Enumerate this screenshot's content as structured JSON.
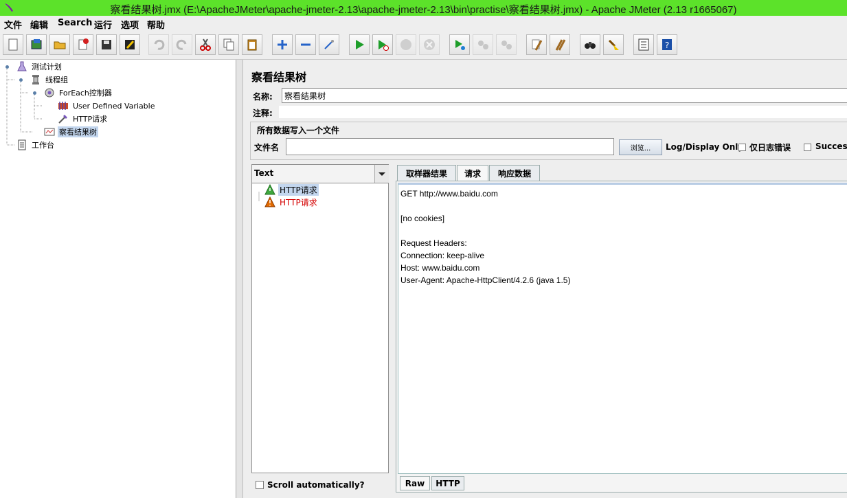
{
  "window": {
    "title": "察看结果树.jmx (E:\\ApacheJMeter\\apache-jmeter-2.13\\apache-jmeter-2.13\\bin\\practise\\察看结果树.jmx) - Apache JMeter (2.13 r1665067)"
  },
  "menu": [
    "文件",
    "编辑",
    "Search",
    "运行",
    "选项",
    "帮助"
  ],
  "tree": {
    "plan": "测试计划",
    "thread_group": "线程组",
    "foreach": "ForEach控制器",
    "udv": "User Defined Variable",
    "http": "HTTP请求",
    "result_tree": "察看结果树",
    "workbench": "工作台"
  },
  "panel": {
    "title": "察看结果树",
    "name_label": "名称:",
    "name_value": "察看结果树",
    "comment_label": "注释:",
    "file_group_title": "所有数据写入一个文件",
    "file_label": "文件名",
    "file_value": "",
    "browse_label": "浏览...",
    "log_display_label": "Log/Display Only:",
    "errors_only_label": "仅日志错误",
    "success_label": "Successes"
  },
  "results": {
    "renderer_selected": "Text",
    "samples": [
      {
        "label": "HTTP请求",
        "status": "success"
      },
      {
        "label": "HTTP请求",
        "status": "failure"
      }
    ],
    "scroll_label": "Scroll automatically?",
    "tabs": [
      "取样器结果",
      "请求",
      "响应数据"
    ],
    "active_tab": "请求",
    "request_lines": [
      "GET http://www.baidu.com",
      "",
      "[no cookies]",
      "",
      "Request Headers:",
      "Connection: keep-alive",
      "Host: www.baidu.com",
      "User-Agent: Apache-HttpClient/4.2.6 (java 1.5)"
    ],
    "bottom_tabs": [
      "Raw",
      "HTTP"
    ]
  },
  "colors": {
    "title_bar": "#5ce22a",
    "selection": "#c3d6ee",
    "error_text": "#d40000",
    "success_icon": "#3fa83f",
    "warning_icon": "#e26a00"
  }
}
